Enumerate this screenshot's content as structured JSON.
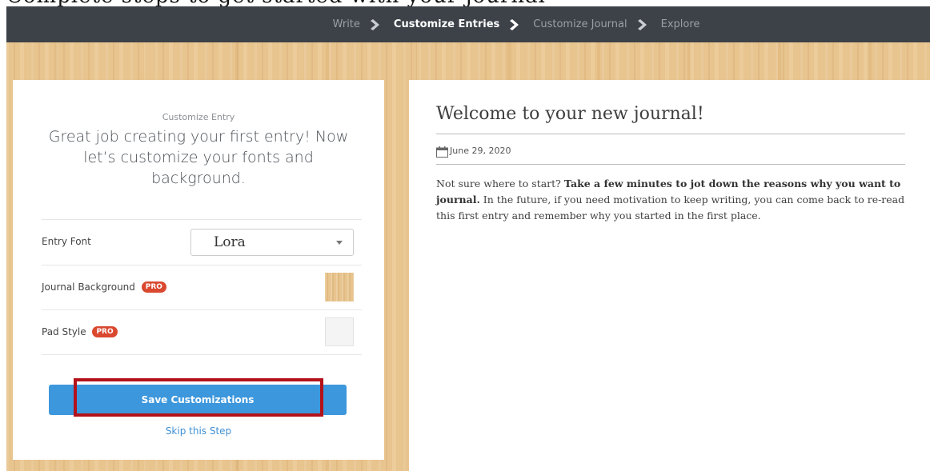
{
  "top_strip": {
    "text": "Complete steps to get started with your journal"
  },
  "nav": {
    "steps": [
      {
        "label": "Write",
        "active": false
      },
      {
        "label": "Customize Entries",
        "active": true
      },
      {
        "label": "Customize Journal",
        "active": false
      },
      {
        "label": "Explore",
        "active": false
      }
    ],
    "separator_icon": "chevron-right-icon"
  },
  "customize_panel": {
    "eyebrow": "Customize Entry",
    "heading": "Great job creating your first entry! Now let’s customize your fonts and background.",
    "entry_font": {
      "label": "Entry Font",
      "selected": "Lora"
    },
    "journal_background": {
      "label": "Journal Background",
      "badge": "PRO"
    },
    "pad_style": {
      "label": "Pad Style",
      "badge": "PRO"
    },
    "save_label": "Save Customizations",
    "skip_label": "Skip this Step"
  },
  "journal": {
    "title": "Welcome to your new journal!",
    "date": "June 29, 2020",
    "body_intro": "Not sure where to start? ",
    "body_bold": "Take a few minutes to jot down the reasons why you want to journal.",
    "body_rest": " In the future, if you need motivation to keep writing, you can come back to re-read this first entry and remember why you started in the first place."
  },
  "colors": {
    "navbar": "#3d4148",
    "accent_button": "#3d97dc",
    "pro_badge": "#d9482f",
    "highlight": "#b3121b",
    "wood": "#e8c48e"
  }
}
